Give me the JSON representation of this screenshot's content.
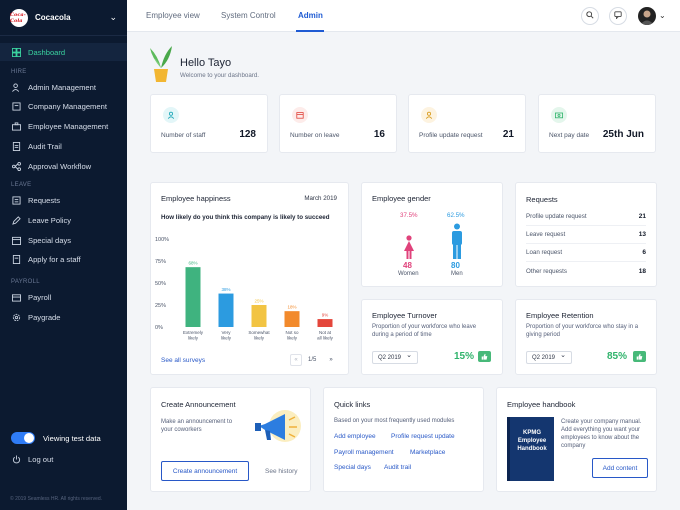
{
  "sidebar": {
    "brand": "Cocacola",
    "brand_logo_text": "Coca-Cola",
    "dashboard": "Dashboard",
    "sections": {
      "hire": "HIRE",
      "leave": "LEAVE",
      "payroll": "PAYROLL"
    },
    "hire_items": [
      "Admin Management",
      "Company Management",
      "Employee Management",
      "Audit Trail",
      "Approval Workflow"
    ],
    "leave_items": [
      "Requests",
      "Leave Policy",
      "Special days",
      "Apply for a staff"
    ],
    "payroll_items": [
      "Payroll",
      "Paygrade"
    ],
    "test_data": "Viewing test data",
    "logout": "Log out",
    "copyright": "© 2019 Seamless HR. All rights reserved."
  },
  "topbar": {
    "tabs": [
      "Employee view",
      "System Control",
      "Admin"
    ],
    "active_tab": "Admin"
  },
  "welcome": {
    "greeting": "Hello Tayo",
    "subtitle": "Welcome to your dashboard."
  },
  "stats": [
    {
      "label": "Number of staff",
      "value": "128",
      "icon": "user-icon",
      "color": "#1aa6b7"
    },
    {
      "label": "Number on leave",
      "value": "16",
      "icon": "calendar-icon",
      "color": "#e0423b"
    },
    {
      "label": "Profile update request",
      "value": "21",
      "icon": "user-icon",
      "color": "#d89a1a"
    },
    {
      "label": "Next pay date",
      "value": "25th Jun",
      "icon": "money-icon",
      "color": "#2fb36b"
    }
  ],
  "happiness": {
    "title": "Employee happiness",
    "date": "March 2019",
    "question": "How likely do you think this company is likely to succeed",
    "see_all": "See all surveys",
    "pager": "1/5"
  },
  "chart_data": {
    "type": "bar",
    "categories": [
      "Extremely likely",
      "Very likely",
      "Somewhat likely",
      "Not so likely",
      "Not at all likely"
    ],
    "values": [
      68,
      38,
      25,
      18,
      9
    ],
    "value_labels": [
      "68%",
      "38%",
      "25%",
      "18%",
      "9%"
    ],
    "ylim": [
      0,
      100
    ],
    "yticks": [
      "100%",
      "75%",
      "50%",
      "25%",
      "0%"
    ],
    "colors": [
      "#3fb37f",
      "#2c9be0",
      "#f2c443",
      "#f28a2c",
      "#e4463b"
    ]
  },
  "gender": {
    "title": "Employee gender",
    "women_pct": "37.5%",
    "men_pct": "62.5%",
    "women_count": "48",
    "men_count": "80",
    "women_label": "Women",
    "men_label": "Men"
  },
  "requests": {
    "title": "Requests",
    "rows": [
      {
        "label": "Profile update request",
        "value": "21"
      },
      {
        "label": "Leave request",
        "value": "13"
      },
      {
        "label": "Loan request",
        "value": "6"
      },
      {
        "label": "Other requests",
        "value": "18"
      }
    ]
  },
  "turnover": {
    "title": "Employee Turnover",
    "desc": "Proportion of your workforce who leave during a period of time",
    "period": "Q2 2019",
    "pct": "15%"
  },
  "retention": {
    "title": "Employee Retention",
    "desc": "Proportion of your workforce who stay in a giving period",
    "period": "Q2 2019",
    "pct": "85%"
  },
  "announcement": {
    "title": "Create Announcement",
    "desc": "Make an announcement to your coworkers",
    "button": "Create announcement",
    "history": "See history"
  },
  "quicklinks": {
    "title": "Quick links",
    "desc": "Based on your most frequently used modules",
    "links": [
      "Add employee",
      "Profile request update",
      "Payroll management",
      "Marketplace",
      "Special days",
      "Audit trail"
    ]
  },
  "handbook": {
    "title": "Employee handbook",
    "book_title": "KPMG Employee Handbook",
    "desc": "Create your company manual. Add everything you want your employees to know about the company",
    "button": "Add content"
  }
}
